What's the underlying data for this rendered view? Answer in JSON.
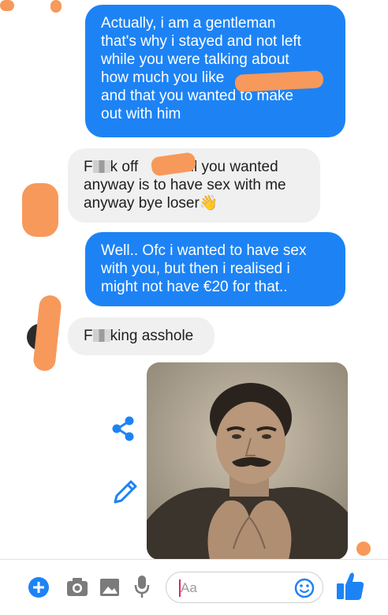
{
  "colors": {
    "outgoing_bubble": "#1d83f5",
    "incoming_bubble": "#f0f0f0",
    "accent": "#1d83f5",
    "redaction": "#f7995a"
  },
  "messages": [
    {
      "direction": "outgoing",
      "lines": [
        "Actually, i am a gentleman",
        "that's why i stayed and not left",
        "while you were talking about",
        "how much you like",
        "and that you wanted to make",
        "out with him"
      ]
    },
    {
      "direction": "incoming",
      "lines": [
        "F",
        "k off",
        "all you wanted",
        "anyway is to have sex with me",
        "anyway bye loser",
        "👋"
      ]
    },
    {
      "direction": "outgoing",
      "lines": [
        "Well.. Ofc i wanted to have sex",
        "with you, but then i realised i",
        "might not have €20 for that.."
      ]
    },
    {
      "direction": "incoming",
      "lines": [
        "F",
        "king asshole"
      ]
    },
    {
      "direction": "incoming",
      "type": "photo"
    }
  ],
  "side_actions": [
    "share-icon",
    "edit-icon"
  ],
  "composer": {
    "tools": [
      "add-icon",
      "camera-icon",
      "gallery-icon",
      "microphone-icon"
    ],
    "placeholder": "Aa",
    "emoji_icon": "emoji-icon",
    "like_icon": "thumbs-up-icon"
  }
}
